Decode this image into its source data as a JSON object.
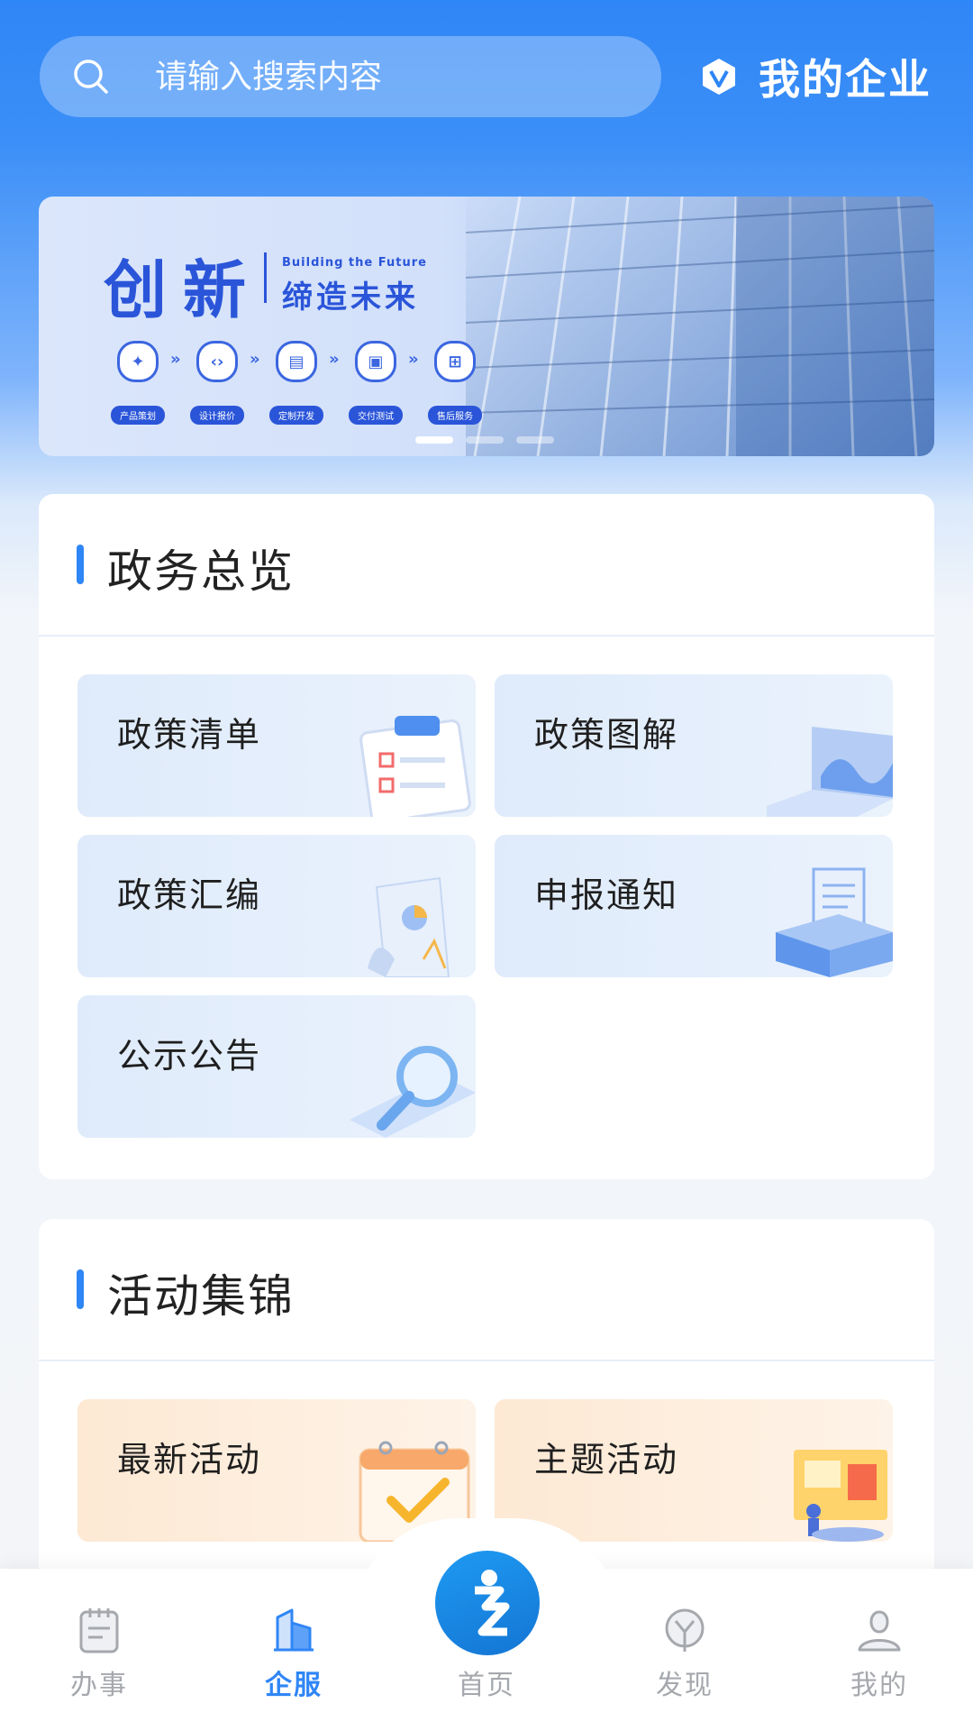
{
  "header": {
    "search_placeholder": "请输入搜索内容",
    "my_company_label": "我的企业"
  },
  "banner": {
    "title": "创新",
    "subtitle_en": "Building the Future",
    "subtitle": "缔造未来",
    "steps": [
      "产品策划",
      "设计报价",
      "定制开发",
      "交付测试",
      "售后服务"
    ],
    "slide_count": 3,
    "active_slide": 1
  },
  "gov_overview": {
    "title": "政务总览",
    "tiles": [
      {
        "label": "政策清单",
        "icon": "clipboard-icon"
      },
      {
        "label": "政策图解",
        "icon": "laptop-chart-icon"
      },
      {
        "label": "政策汇编",
        "icon": "document-chart-icon"
      },
      {
        "label": "申报通知",
        "icon": "document-box-icon"
      },
      {
        "label": "公示公告",
        "icon": "magnifier-icon"
      }
    ]
  },
  "activities": {
    "title": "活动集锦",
    "tiles": [
      {
        "label": "最新活动",
        "icon": "calendar-check-icon"
      },
      {
        "label": "主题活动",
        "icon": "event-board-icon"
      }
    ]
  },
  "bottom_nav": [
    {
      "label": "办事",
      "icon": "notepad-icon",
      "active": false
    },
    {
      "label": "企服",
      "icon": "buildings-icon",
      "active": true
    },
    {
      "label": "首页",
      "icon": "home-logo-icon",
      "active": false
    },
    {
      "label": "发现",
      "icon": "discover-icon",
      "active": false
    },
    {
      "label": "我的",
      "icon": "profile-icon",
      "active": false
    }
  ],
  "colors": {
    "primary": "#2f86f6",
    "banner_text": "#2a55d9",
    "nav_inactive": "#a5a8ad"
  }
}
